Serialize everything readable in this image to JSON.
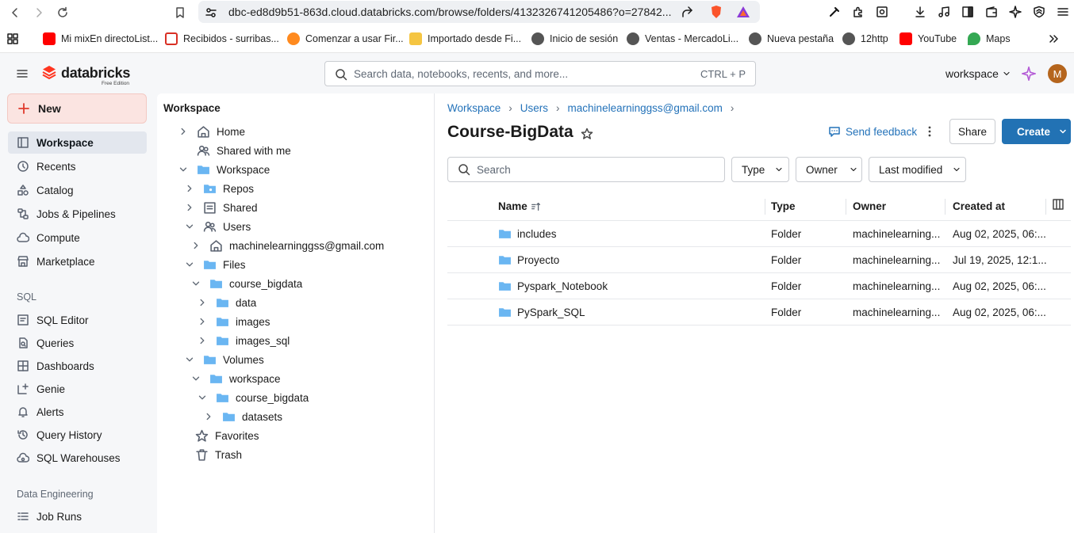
{
  "browser": {
    "url": "dbc-ed8d9b51-863d.cloud.databricks.com/browse/folders/4132326741205486?o=27842...",
    "bookmarks": [
      "Mi mixEn directoList...",
      "Recibidos - surribas...",
      "Comenzar a usar Fir...",
      "Importado desde Fi...",
      "Inicio de sesión",
      "Ventas - MercadoLi...",
      "Nueva pestaña",
      "12http",
      "YouTube",
      "Maps"
    ]
  },
  "header": {
    "brand": "databricks",
    "edition": "Free Edition",
    "search_placeholder": "Search data, notebooks, recents, and more...",
    "search_shortcut": "CTRL + P",
    "workspace_switch": "workspace",
    "avatar_initial": "M"
  },
  "sidebar": {
    "new_label": "New",
    "items": [
      "Workspace",
      "Recents",
      "Catalog",
      "Jobs & Pipelines",
      "Compute",
      "Marketplace"
    ],
    "sql_section": "SQL",
    "sql_items": [
      "SQL Editor",
      "Queries",
      "Dashboards",
      "Genie",
      "Alerts",
      "Query History",
      "SQL Warehouses"
    ],
    "de_section": "Data Engineering",
    "de_items": [
      "Job Runs"
    ]
  },
  "tree": {
    "title": "Workspace",
    "nodes": [
      "Home",
      "Shared with me",
      "Workspace",
      "Repos",
      "Shared",
      "Users",
      "machinelearninggss@gmail.com",
      "Files",
      "course_bigdata",
      "data",
      "images",
      "images_sql",
      "Volumes",
      "workspace",
      "course_bigdata",
      "datasets",
      "Favorites",
      "Trash"
    ]
  },
  "main": {
    "breadcrumb": [
      "Workspace",
      "Users",
      "machinelearninggss@gmail.com"
    ],
    "title": "Course-BigData",
    "feedback_label": "Send feedback",
    "share_label": "Share",
    "create_label": "Create",
    "search_placeholder": "Search",
    "filters": [
      "Type",
      "Owner",
      "Last modified"
    ],
    "columns": [
      "Name",
      "Type",
      "Owner",
      "Created at"
    ],
    "rows": [
      {
        "name": "includes",
        "type": "Folder",
        "owner": "machinelearning...",
        "created": "Aug 02, 2025, 06:..."
      },
      {
        "name": "Proyecto",
        "type": "Folder",
        "owner": "machinelearning...",
        "created": "Jul 19, 2025, 12:1..."
      },
      {
        "name": "Pyspark_Notebook",
        "type": "Folder",
        "owner": "machinelearning...",
        "created": "Aug 02, 2025, 06:..."
      },
      {
        "name": "PySpark_SQL",
        "type": "Folder",
        "owner": "machinelearning...",
        "created": "Aug 02, 2025, 06:..."
      }
    ]
  },
  "colors": {
    "accent": "#2372b9",
    "primary_button": "#2272b4",
    "brand": "#ff3621",
    "folder": "#6ab6f2"
  }
}
